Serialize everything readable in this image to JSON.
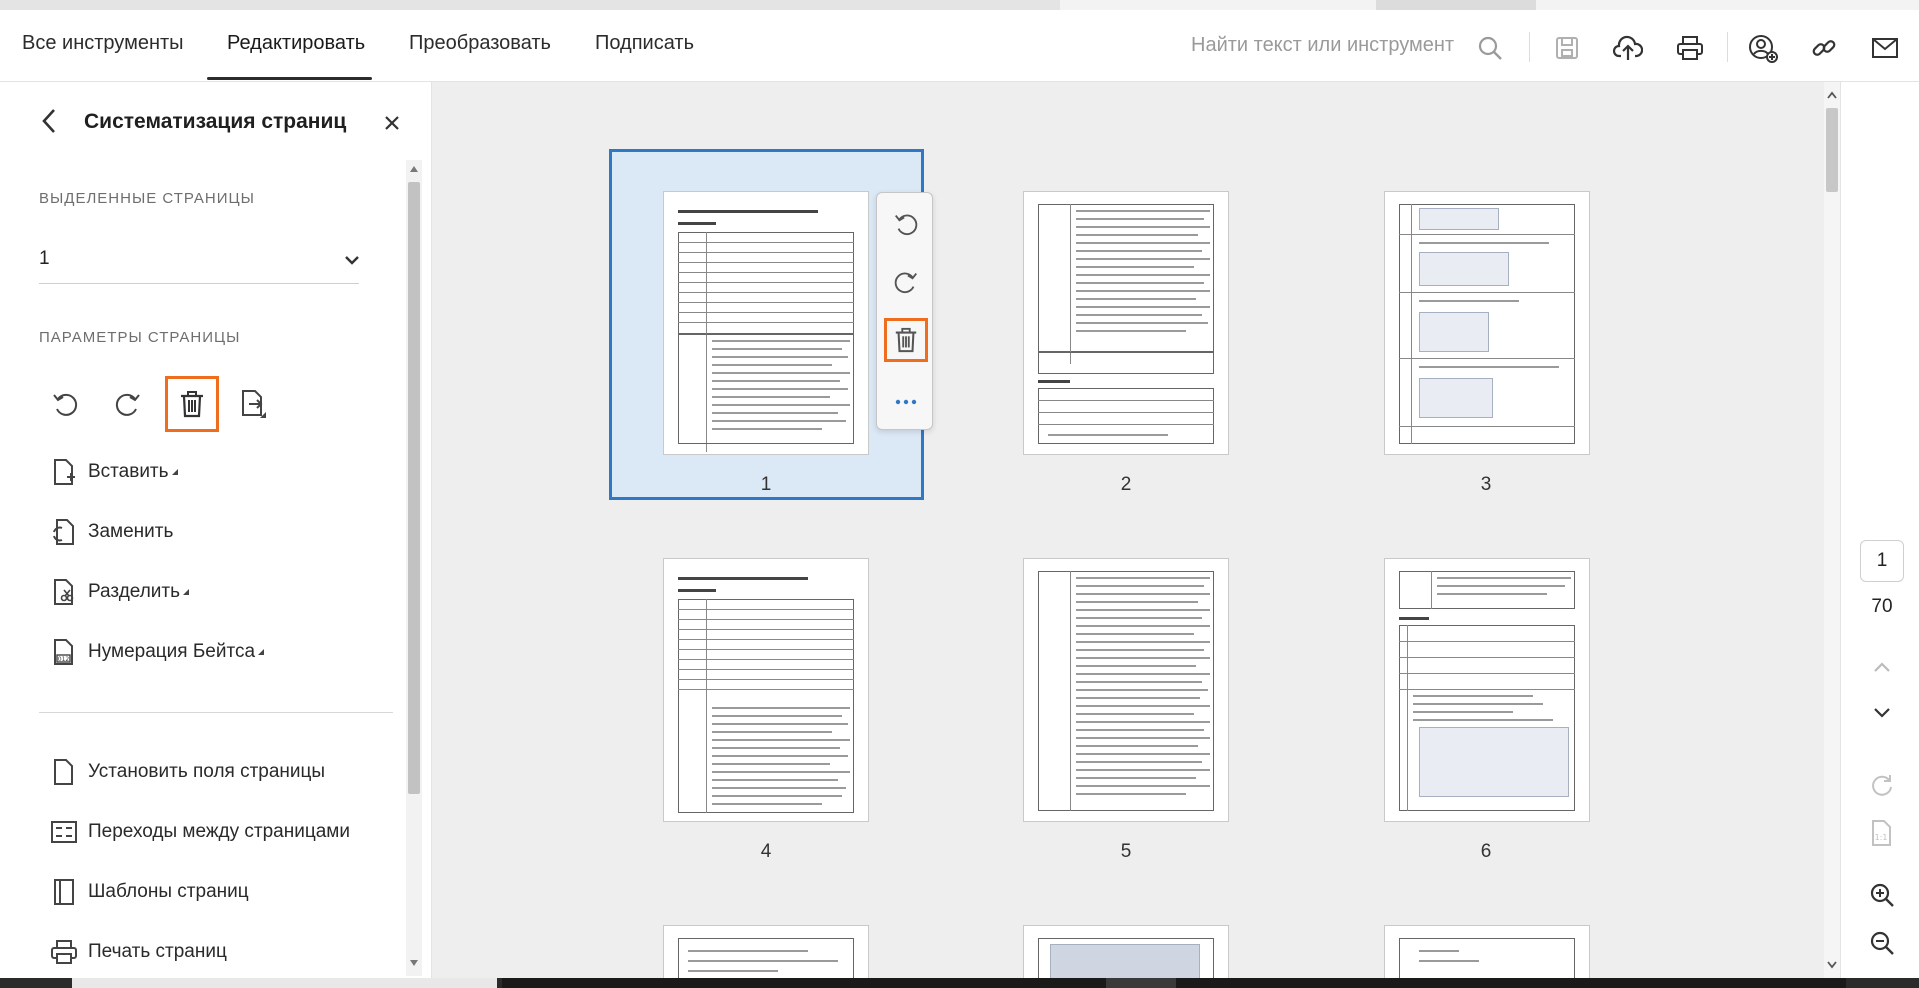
{
  "menubar": {
    "tabs": [
      "Все инструменты",
      "Редактировать",
      "Преобразовать",
      "Подписать"
    ],
    "active_tab": "Редактировать",
    "search_placeholder": "Найти текст или инструмент",
    "icons": [
      "search-icon",
      "save-icon",
      "cloud-upload-icon",
      "print-icon",
      "share-user-icon",
      "link-icon",
      "mail-icon"
    ]
  },
  "left_panel": {
    "title": "Систематизация страниц",
    "selected_pages_heading": "ВЫДЕЛЕННЫЕ СТРАНИЦЫ",
    "selected_value": "1",
    "page_params_heading": "ПАРАМЕТРЫ СТРАНИЦЫ",
    "tools": [
      "Вставить",
      "Заменить",
      "Разделить",
      "Нумерация Бейтса",
      "Установить поля страницы",
      "Переходы между страницами",
      "Шаблоны страниц",
      "Печать страниц"
    ]
  },
  "thumbnails": {
    "pages": [
      "1",
      "2",
      "3",
      "4",
      "5",
      "6"
    ],
    "selected": "1",
    "accent_color": "#2e78c6",
    "highlight_color": "#ee6d1f"
  },
  "right_rail": {
    "current_page": "1",
    "total_pages": "70"
  }
}
